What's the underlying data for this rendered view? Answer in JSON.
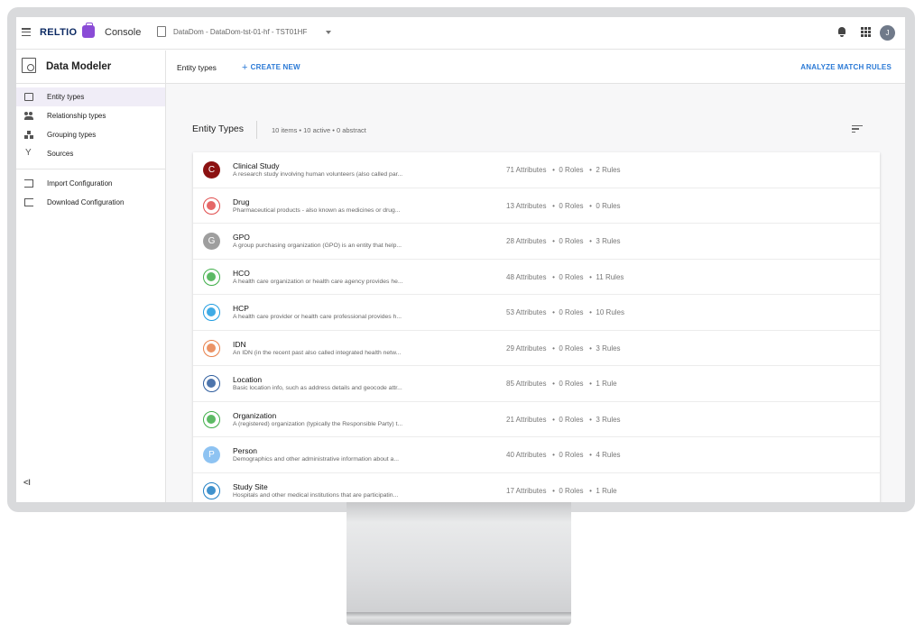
{
  "topbar": {
    "brand": "RELTIO",
    "app": "Console",
    "tenant": "DataDom - DataDom-tst-01-hf - TST01HF",
    "avatar_initial": "J",
    "icons": [
      "menu-icon",
      "briefcase-icon",
      "tenant-icon",
      "chevron-down-icon",
      "bell-icon",
      "apps-icon"
    ]
  },
  "sidebar": {
    "title": "Data Modeler",
    "items": [
      {
        "label": "Entity types",
        "icon": "entity-types-icon",
        "active": true
      },
      {
        "label": "Relationship types",
        "icon": "people-icon"
      },
      {
        "label": "Grouping types",
        "icon": "grouping-icon"
      },
      {
        "label": "Sources",
        "icon": "sources-icon"
      }
    ],
    "actions": [
      {
        "label": "Import Configuration",
        "icon": "import-icon"
      },
      {
        "label": "Download Configuration",
        "icon": "download-icon"
      }
    ],
    "collapse": "<I"
  },
  "main": {
    "header_title": "Entity types",
    "create_label": "CREATE NEW",
    "analyze_label": "ANALYZE MATCH RULES",
    "list_title": "Entity Types",
    "summary": "10 items • 10 active • 0 abstract",
    "rows": [
      {
        "name": "Clinical Study",
        "desc": "A research study involving human volunteers (also called par...",
        "stats": "71 Attributes   •  0 Roles   •  2 Rules",
        "icon": "C",
        "color": "#8b1111"
      },
      {
        "name": "Drug",
        "desc": "Pharmaceutical products - also known as medicines or drug...",
        "stats": "13 Attributes   •  0 Roles   •  0 Rules",
        "icon": "",
        "color": "#e04c4c"
      },
      {
        "name": "GPO",
        "desc": "A group purchasing organization (GPO) is an entity that help...",
        "stats": "28 Attributes   •  0 Roles   •  3 Rules",
        "icon": "G",
        "color": "#9e9e9e"
      },
      {
        "name": "HCO",
        "desc": "A health care organization or health care agency provides he...",
        "stats": "48 Attributes   •  0 Roles   •  11 Rules",
        "icon": "",
        "color": "#3fae49"
      },
      {
        "name": "HCP",
        "desc": "A health care provider or health care professional provides h...",
        "stats": "53 Attributes   •  0 Roles   •  10 Rules",
        "icon": "",
        "color": "#1f9ce0"
      },
      {
        "name": "IDN",
        "desc": "An IDN (in the recent past also called integrated health netw...",
        "stats": "29 Attributes   •  0 Roles   •  3 Rules",
        "icon": "",
        "color": "#e8804a"
      },
      {
        "name": "Location",
        "desc": "Basic location info, such as address details and geocode attr...",
        "stats": "85 Attributes   •  0 Roles   •  1 Rule",
        "icon": "",
        "color": "#2e5d9e"
      },
      {
        "name": "Organization",
        "desc": "A (registered) organization (typically the Responsible Party) t...",
        "stats": "21 Attributes   •  0 Roles   •  3 Rules",
        "icon": "",
        "color": "#3fae49"
      },
      {
        "name": "Person",
        "desc": "Demographics and other administrative information about a...",
        "stats": "40 Attributes   •  0 Roles   •  4 Rules",
        "icon": "P",
        "color": "#8ec3f2"
      },
      {
        "name": "Study Site",
        "desc": "Hospitals and other medical institutions that are participatin...",
        "stats": "17 Attributes   •  0 Roles   •  1 Rule",
        "icon": "",
        "color": "#1f7fc4"
      }
    ]
  }
}
